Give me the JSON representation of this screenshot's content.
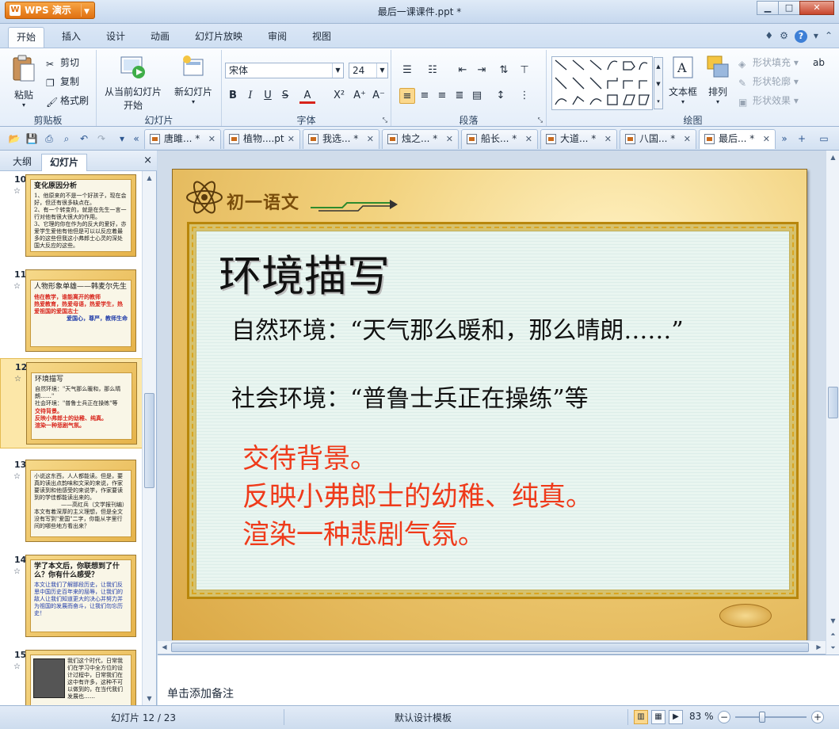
{
  "window": {
    "app_name": "WPS 演示",
    "title": "最后一课课件.ppt *",
    "controls": {
      "minimize": "▁",
      "maximize": "□",
      "close": "✕"
    }
  },
  "menu": {
    "tabs": [
      "开始",
      "插入",
      "设计",
      "动画",
      "幻灯片放映",
      "审阅",
      "视图"
    ],
    "active": "开始"
  },
  "ribbon": {
    "clipboard": {
      "label": "剪贴板",
      "paste": "粘贴",
      "cut": "剪切",
      "copy": "复制",
      "format_painter": "格式刷"
    },
    "slides": {
      "label": "幻灯片",
      "from_current_line1": "从当前幻灯片",
      "from_current_line2": "开始",
      "new_slide": "新幻灯片"
    },
    "font": {
      "label": "字体",
      "font_name": "宋体",
      "font_size": "24",
      "bold": "B",
      "italic": "I",
      "underline": "U",
      "strike": "S",
      "font_color": "A",
      "superscript": "X²",
      "grow": "A⁺",
      "shrink": "A⁻"
    },
    "paragraph": {
      "label": "段落"
    },
    "drawing": {
      "label": "绘图",
      "textbox": "文本框",
      "arrange": "排列",
      "shape_fill": "形状填充",
      "shape_outline": "形状轮廓",
      "shape_effect": "形状效果"
    }
  },
  "doc_tabs": [
    {
      "name": "唐雎... *"
    },
    {
      "name": "植物....pt"
    },
    {
      "name": "我选... *"
    },
    {
      "name": "烛之... *"
    },
    {
      "name": "船长... *"
    },
    {
      "name": "大道... *"
    },
    {
      "name": "八国... *"
    },
    {
      "name": "最后... *"
    }
  ],
  "left_panel": {
    "tabs": [
      "大纲",
      "幻灯片"
    ],
    "active": "幻灯片",
    "close": "×",
    "thumbnails": [
      {
        "num": "10",
        "title": "变化原因分析",
        "lines": [
          "1、他原来的不是一个好孩子，现在会好，但还有很多缺点在。",
          "2、有一个转变的，就是在先生一言一行对他有很大很大的作用。",
          "3、它理的你在作为的反大的爱好，亦爱学生爱他有他但是可以以反应着最多的这些但我这小弗郎士心灵的深处国大反应的这些。"
        ]
      },
      {
        "num": "11",
        "title": "人物形象单雄——韩麦尔先生",
        "lines": [
          "他在教学，谁能离开的教师",
          "热爱教育，热爱母语，热爱学生，热爱祖国的爱国志士",
          "爱国心，尊严，教师生命"
        ]
      },
      {
        "num": "12",
        "title": "环境描写",
        "lines": [
          "自然环境：\"天气那么暖和，那么晴朗……\"",
          "社会环境：\"普鲁士兵正在操练\"等",
          "交待背景。",
          "反映小弗郎士的幼稚、纯真。",
          "渲染一种悲剧气氛。"
        ]
      },
      {
        "num": "13",
        "title": "",
        "lines": [
          "小说这东西，人人都能读。但是，要真的读出点韵味和文采的来说，作家要读到和他感受的来说学，作家要读到的学佳都能读出来的。",
          "——高红兵（文学报刊编）",
          "本文有着深厚的主义理想，但是全文没有写到\"爱国\"二字，你能从字里行间的哪些地方看出来？"
        ]
      },
      {
        "num": "14",
        "title": "学了本文后，你联想到了什么？你有什么感受？",
        "lines": [
          "本文让我们了解那段历史，让我们反思中国历史百年来的屈辱，让我们的敌人让我们知道更大的决心并努力并为祖国的发展而奋斗，让我们勿忘历史！"
        ]
      },
      {
        "num": "15",
        "title": "",
        "lines": [
          "我们这个时代，日常我们在学习中全方位的设计过程中，日常我们在这中有许多，这种不可以做到的，在当代我们发展也……"
        ]
      }
    ],
    "selected": "12"
  },
  "slide": {
    "banner": "初一语文",
    "title": "环境描写",
    "line1": "自然环境：“天气那么暖和，那么晴朗……”",
    "line2": "社会环境：“普鲁士兵正在操练”等",
    "red_lines": [
      "交待背景。",
      "反映小弗郎士的幼稚、纯真。",
      "渲染一种悲剧气氛。"
    ]
  },
  "notes": {
    "placeholder": "单击添加备注"
  },
  "status": {
    "slide_count": "幻灯片 12 / 23",
    "template": "默认设计模板",
    "zoom": "83 %",
    "zoom_minus": "−",
    "zoom_plus": "+"
  },
  "colors": {
    "accent_orange": "#e07010",
    "slide_red_text": "#ef3a1a",
    "selection": "#fce7a8"
  }
}
